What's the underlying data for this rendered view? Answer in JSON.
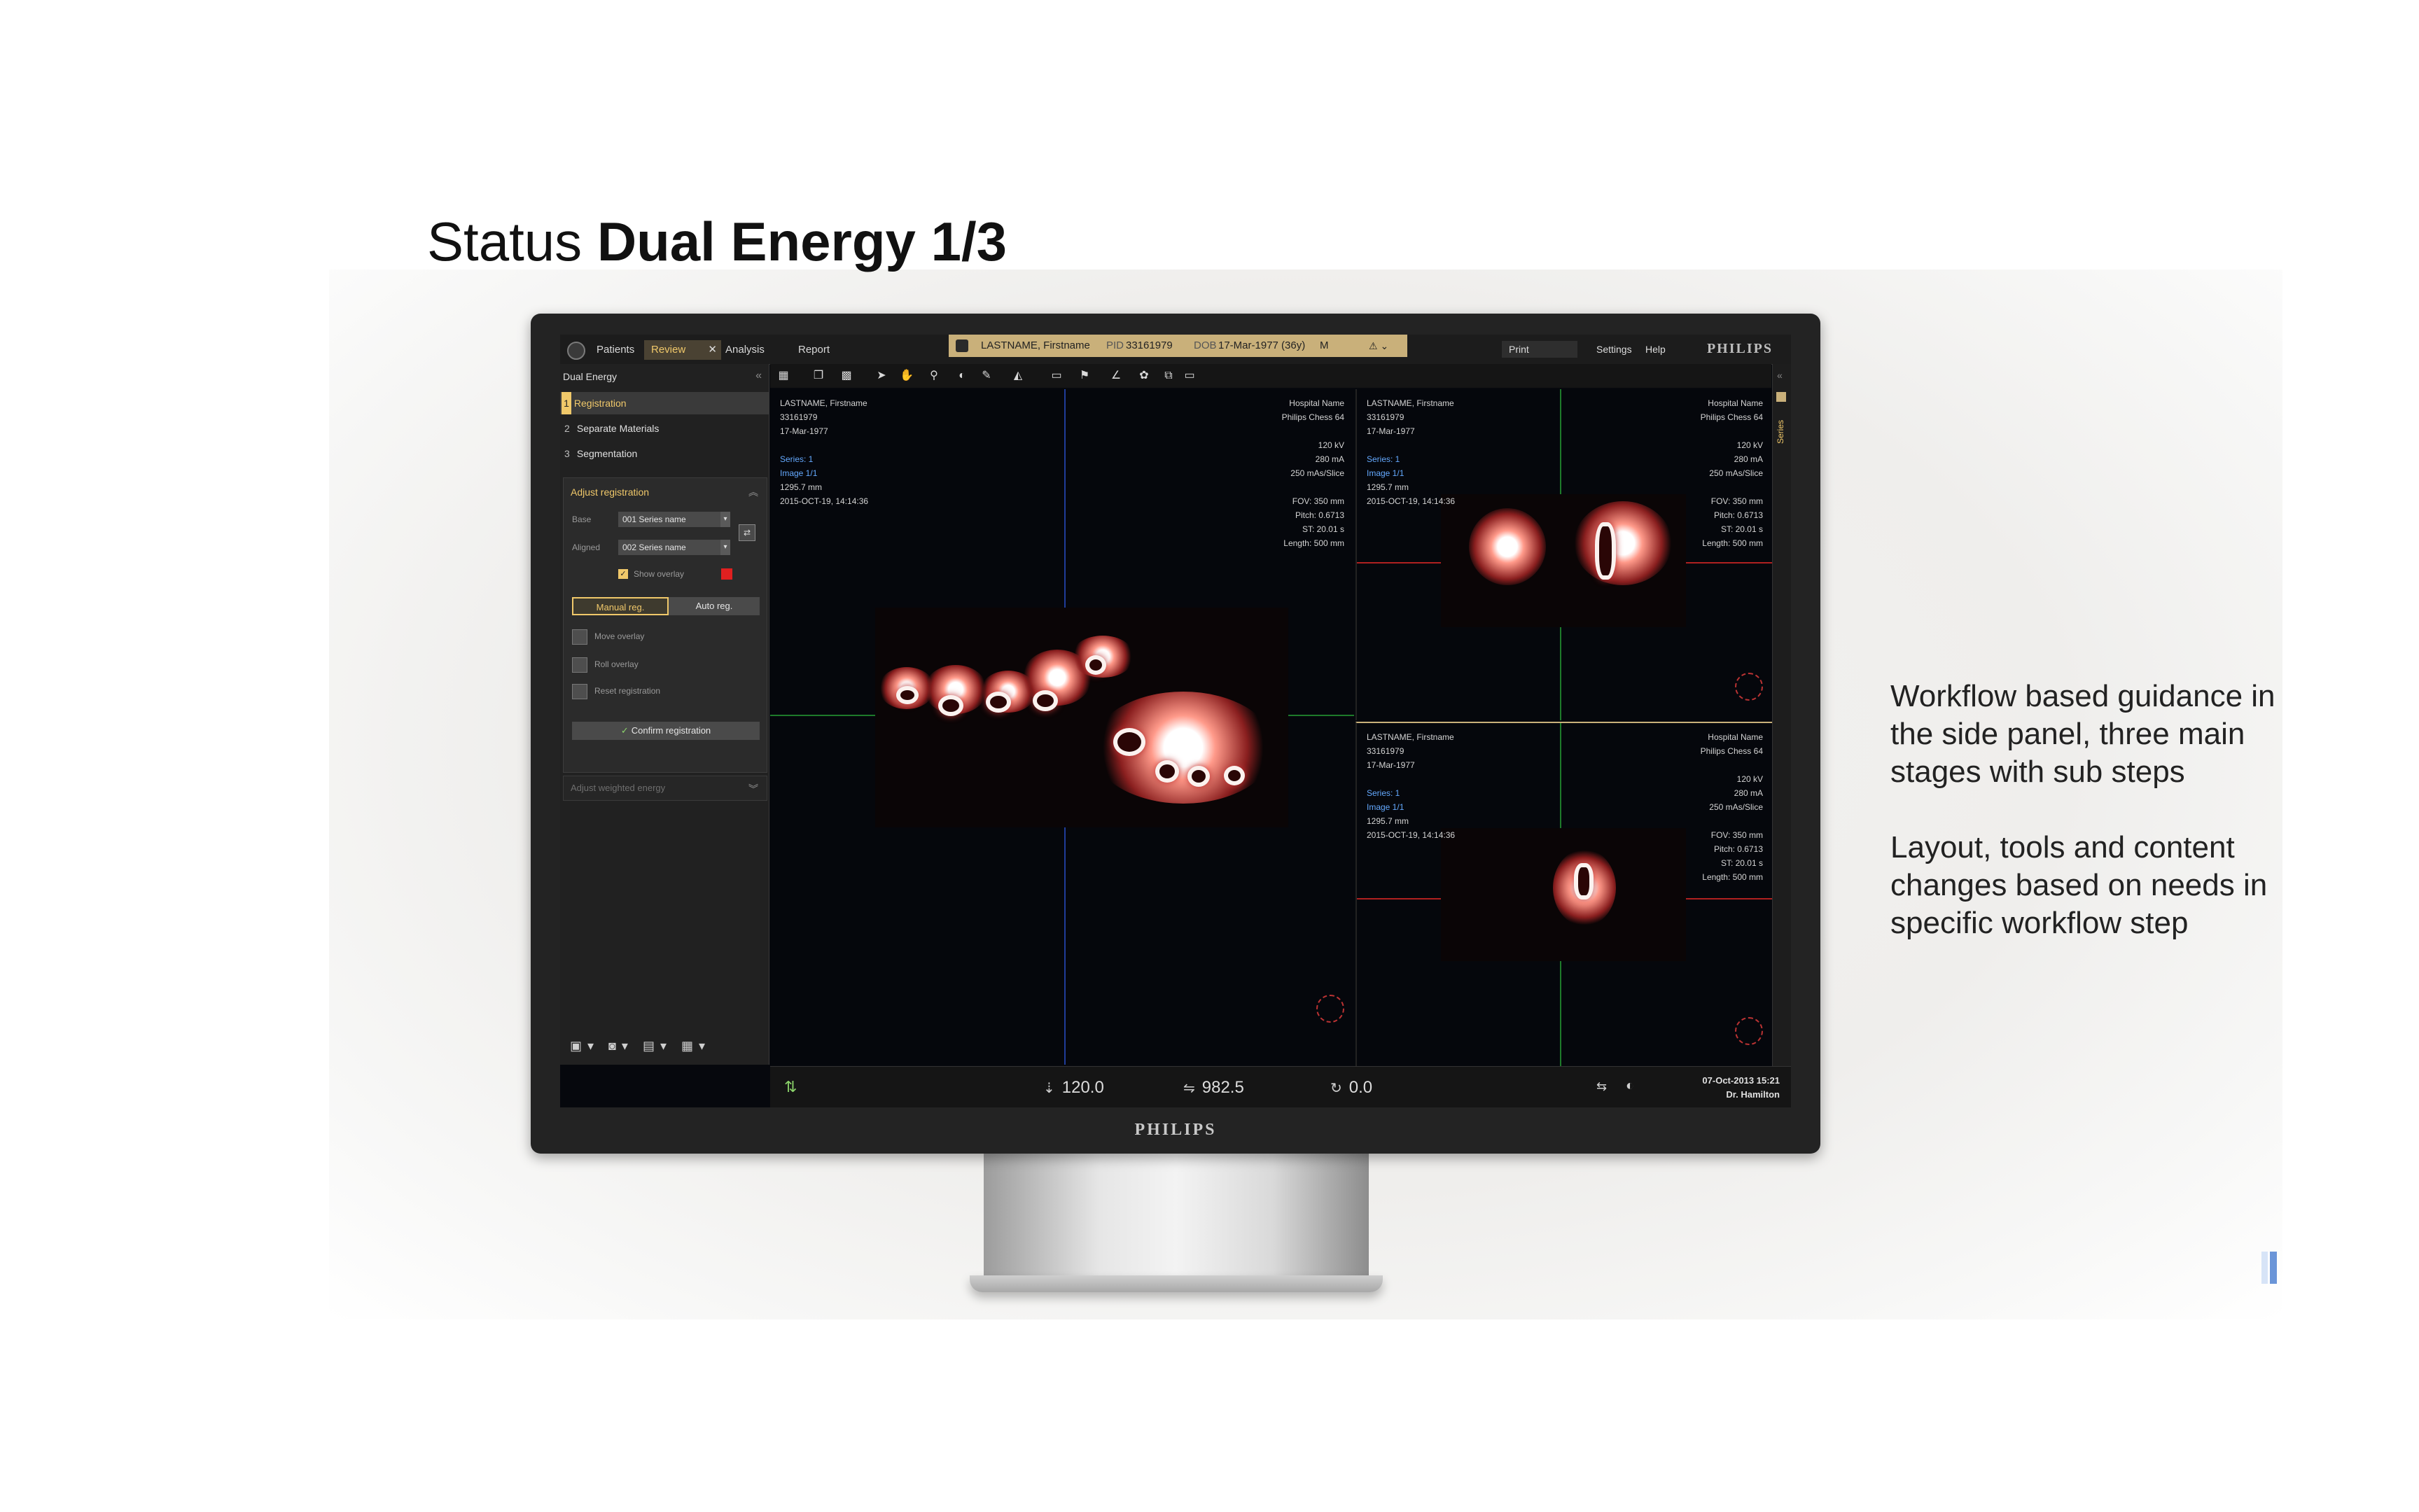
{
  "slide": {
    "title_regular": "Status ",
    "title_bold": "Dual Energy 1/3",
    "notes": [
      "Workflow based guidance in the side panel, three main stages with sub steps",
      "Layout, tools and content changes based on needs in specific workflow step"
    ]
  },
  "monitor": {
    "brand": "PHILIPS"
  },
  "app": {
    "tabs": [
      "Patients",
      "Review",
      "Analysis",
      "Report"
    ],
    "active_tab": "Review",
    "patient": {
      "name": "LASTNAME, Firstname",
      "pid_label": "PID",
      "pid": "33161979",
      "dob_label": "DOB",
      "dob": "17-Mar-1977 (36y)",
      "sex": "M"
    },
    "top_right": {
      "print": "Print",
      "settings": "Settings",
      "help": "Help",
      "brand": "PHILIPS"
    },
    "side_panel": {
      "title": "Dual Energy",
      "steps": [
        {
          "num": "1",
          "label": "Registration"
        },
        {
          "num": "2",
          "label": "Separate Materials"
        },
        {
          "num": "3",
          "label": "Segmentation"
        }
      ],
      "section_title": "Adjust registration",
      "base_label": "Base",
      "base_value": "001 Series name",
      "aligned_label": "Aligned",
      "aligned_value": "002 Series name",
      "show_overlay": "Show overlay",
      "manual_reg": "Manual reg.",
      "auto_reg": "Auto reg.",
      "tools": [
        "Move overlay",
        "Roll overlay",
        "Reset registration"
      ],
      "confirm": "Confirm registration",
      "collapsed_section": "Adjust weighted energy"
    },
    "viewport_info": {
      "name": "LASTNAME, Firstname",
      "id": "33161979",
      "dob": "17-Mar-1977",
      "series": "Series: 1",
      "image": "Image 1/1",
      "mm": "1295.7 mm",
      "datetime": "2015-OCT-19, 14:14:36",
      "hospital": "Hospital Name",
      "scanner": "Philips Chess 64",
      "kv": "120 kV",
      "ma": "280 mA",
      "mas": "250 mAs/Slice",
      "fov": "FOV: 350 mm",
      "pitch": "Pitch: 0.6713",
      "st": "ST: 20.01 s",
      "length": "Length: 500 mm"
    },
    "status": {
      "val1": "120.0",
      "val2": "982.5",
      "val3": "0.0",
      "date": "07-Oct-2013  15:21",
      "user": "Dr. Hamilton"
    },
    "rail_label": "Series"
  },
  "colors": {
    "accent": "#f0c86a",
    "banner": "#c9b07a",
    "overlay_red": "#e02020"
  }
}
